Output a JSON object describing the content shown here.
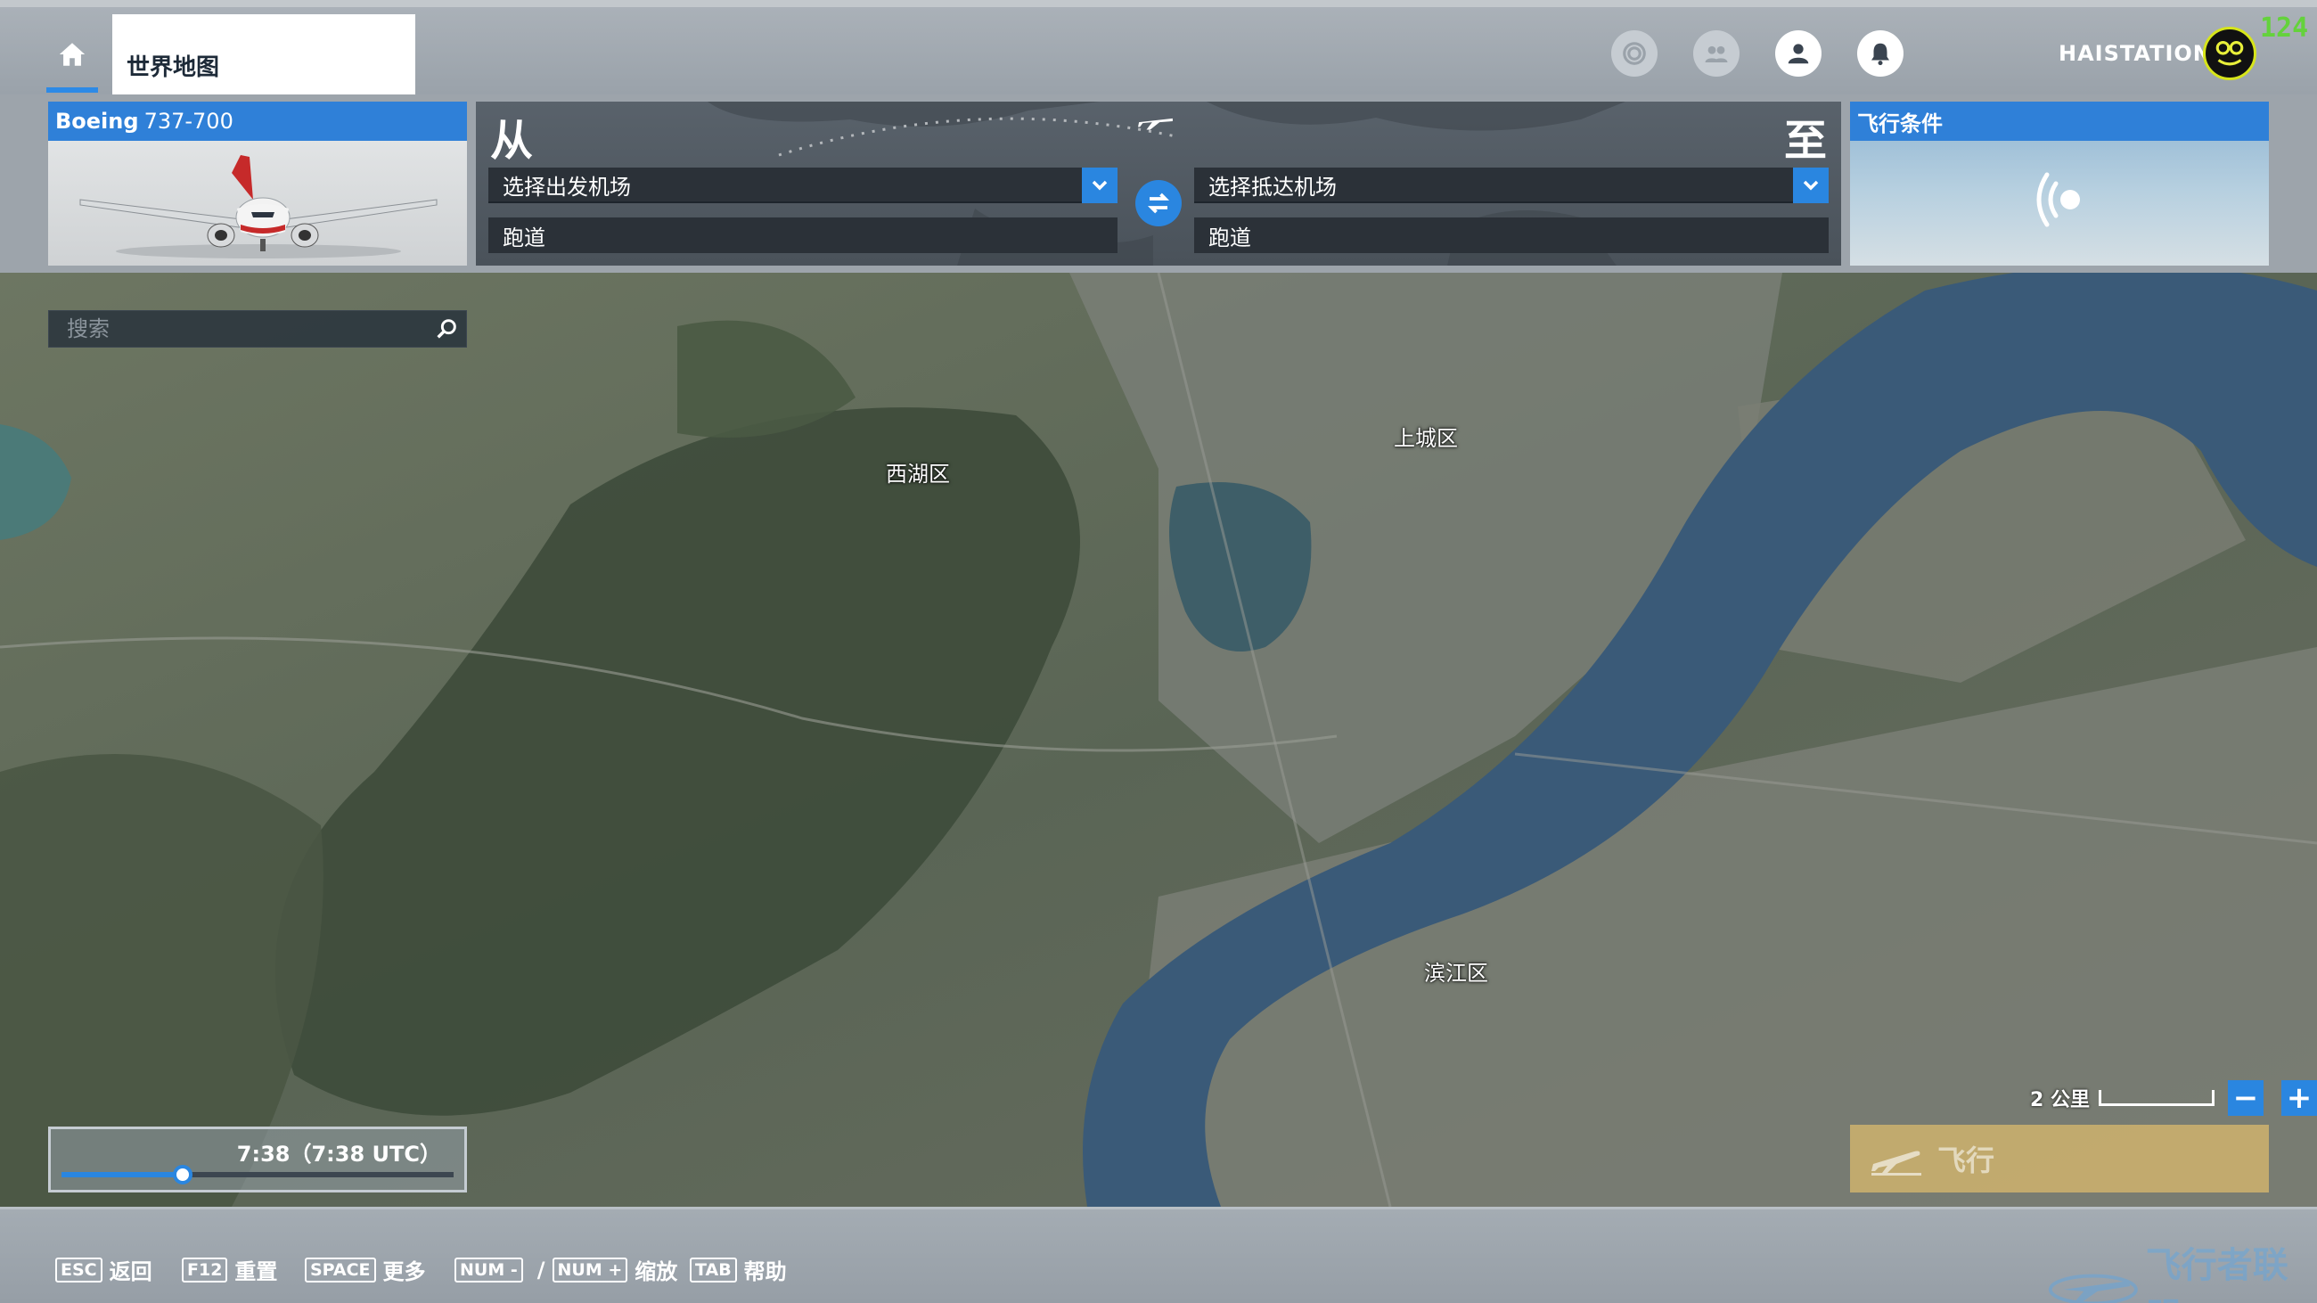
{
  "topbar": {
    "home_icon": "home-icon",
    "worldmap_tab": "世界地图",
    "icons": [
      "achievements-icon",
      "friends-icon",
      "profile-icon",
      "notifications-icon"
    ],
    "username": "HAISTATION",
    "fps": "124"
  },
  "aircraft": {
    "brand": "Boeing",
    "model": "737-700"
  },
  "route": {
    "from_label": "从",
    "to_label": "至",
    "departure_placeholder": "选择出发机场",
    "arrival_placeholder": "选择抵达机场",
    "departure_runway": "跑道",
    "arrival_runway": "跑道"
  },
  "conditions": {
    "title": "飞行条件"
  },
  "map": {
    "search_placeholder": "搜索",
    "districts": [
      "西湖区",
      "上城区",
      "滨江区"
    ],
    "time": "7:38（7:38 UTC）",
    "time_progress": 0.31,
    "scale": "2 公里",
    "zoom_out": "−",
    "zoom_in": "+",
    "fly_label": "飞行"
  },
  "footer": {
    "hints": [
      {
        "key": "ESC",
        "label": "返回"
      },
      {
        "key": "F12",
        "label": "重置"
      },
      {
        "key": "SPACE",
        "label": "更多"
      },
      {
        "key": "NUM -",
        "key2": "NUM +",
        "sep": "/",
        "label": "缩放"
      },
      {
        "key": "TAB",
        "label": "帮助"
      }
    ],
    "watermark": "飞行者联盟"
  },
  "colors": {
    "accent": "#2a86e0",
    "fly_button": "#d2b46e",
    "fps": "#64d23c"
  }
}
